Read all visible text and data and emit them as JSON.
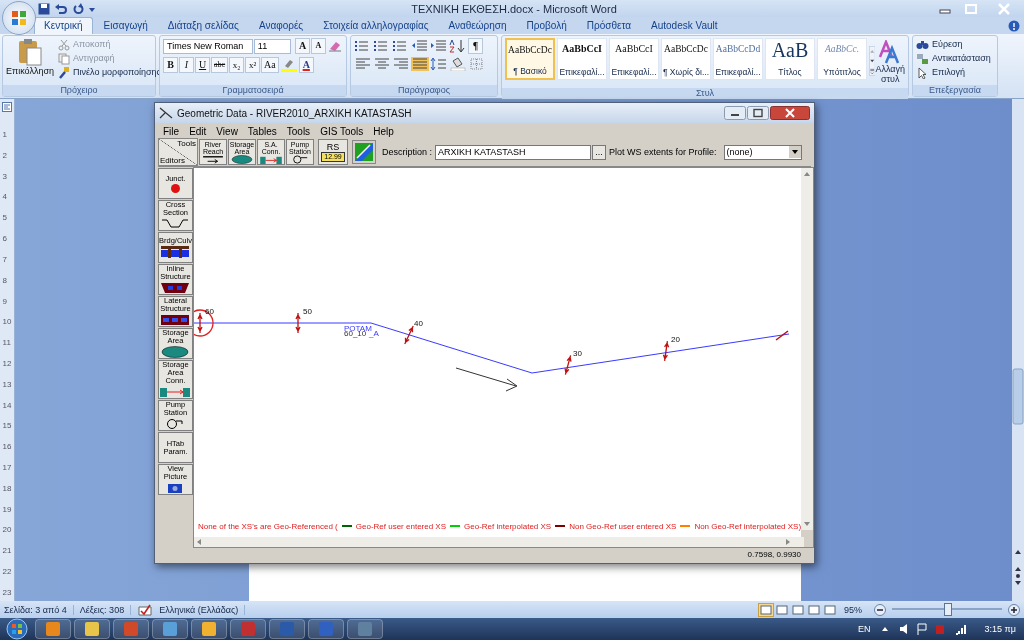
{
  "word": {
    "title": "ΤΕΧΝΙΚΗ ΕΚΘΕΣΗ.docx - Microsoft Word",
    "tabs": [
      {
        "label": "Κεντρική",
        "selected": true
      },
      {
        "label": "Εισαγωγή",
        "selected": false
      },
      {
        "label": "Διάταξη σελίδας",
        "selected": false
      },
      {
        "label": "Αναφορές",
        "selected": false
      },
      {
        "label": "Στοιχεία αλληλογραφίας",
        "selected": false
      },
      {
        "label": "Αναθεώρηση",
        "selected": false
      },
      {
        "label": "Προβολή",
        "selected": false
      },
      {
        "label": "Πρόσθετα",
        "selected": false
      },
      {
        "label": "Autodesk Vault",
        "selected": false
      }
    ],
    "clipboard": {
      "group": "Πρόχειρο",
      "paste": "Επικόλληση",
      "items": [
        {
          "label": "Αποκοπή",
          "kind": "cut",
          "disabled": true
        },
        {
          "label": "Αντιγραφή",
          "kind": "copy",
          "disabled": true
        },
        {
          "label": "Πινέλο μορφοποίησης",
          "kind": "brush",
          "disabled": false
        }
      ]
    },
    "font": {
      "group": "Γραμματοσειρά",
      "family": "Times New Roman",
      "size": "11",
      "grow": "A",
      "shrink": "A",
      "buttons": [
        {
          "label": "B",
          "kind": "bold"
        },
        {
          "label": "I",
          "kind": "italic"
        },
        {
          "label": "U",
          "kind": "underline"
        },
        {
          "label": "abc",
          "kind": "strike"
        },
        {
          "label": "x₂",
          "kind": "sub"
        },
        {
          "label": "x²",
          "kind": "sup"
        },
        {
          "label": "Aa",
          "kind": "case"
        }
      ],
      "color_button": "A"
    },
    "paragraph": {
      "group": "Παράγραφος",
      "pilcrow": "¶"
    },
    "styles": {
      "group": "Στυλ",
      "change": "Αλλαγή στυλ",
      "items": [
        {
          "sample": "AaBbCcDc",
          "name": "¶ Βασικό",
          "kind": "body",
          "selected": true
        },
        {
          "sample": "AaBbCcI",
          "name": "Επικεφαλί...",
          "kind": "heading1",
          "selected": false
        },
        {
          "sample": "AaBbCcI",
          "name": "Επικεφαλί...",
          "kind": "heading2",
          "selected": false
        },
        {
          "sample": "AaBbCcDc",
          "name": "¶ Χωρίς δι...",
          "kind": "nospacing",
          "selected": false
        },
        {
          "sample": "AaBbCcDd",
          "name": "Επικεφαλί...",
          "kind": "heading3",
          "selected": false
        },
        {
          "sample": "AaB",
          "name": "Τίτλος",
          "kind": "title",
          "selected": false
        },
        {
          "sample": "AaBbCc.",
          "name": "Υπότιτλος",
          "kind": "subtitle",
          "selected": false
        }
      ]
    },
    "editing": {
      "group": "Επεξεργασία",
      "items": [
        {
          "label": "Εύρεση",
          "kind": "find"
        },
        {
          "label": "Αντικατάσταση",
          "kind": "replace"
        },
        {
          "label": "Επιλογή",
          "kind": "select"
        }
      ]
    },
    "ruler_numbers": [
      "1",
      "2",
      "3",
      "4",
      "5",
      "6",
      "7",
      "8",
      "9",
      "10",
      "11",
      "12",
      "13",
      "14",
      "15",
      "16",
      "17",
      "18",
      "19",
      "20",
      "21",
      "22",
      "23"
    ]
  },
  "dialog": {
    "title": "Geometric Data - RIVER2010_ARXIKH KATASTASH",
    "menu": [
      "File",
      "Edit",
      "View",
      "Tables",
      "Tools",
      "GIS Tools",
      "Help"
    ],
    "tools_label": "Tools",
    "editors_label": "Editors",
    "tool_buttons": [
      {
        "label": "River Reach",
        "kind": "reach"
      },
      {
        "label": "Storage Area",
        "kind": "storage"
      },
      {
        "label": "S.A. Conn.",
        "kind": "conn"
      },
      {
        "label": "Pump Station",
        "kind": "pump"
      }
    ],
    "rs_button": {
      "label": "RS",
      "tag": "12.99"
    },
    "description_label": "Description :",
    "description": "ARXIKH KATASTASH",
    "browse": "...",
    "profile_label": "Plot WS extents for Profile:",
    "profile": "(none)",
    "editors": [
      {
        "label": "Junct.",
        "kind": "junction"
      },
      {
        "label": "Cross Section",
        "kind": "xs"
      },
      {
        "label": "Brdg/Culv",
        "kind": "bridge"
      },
      {
        "label": "Inline Structure",
        "kind": "inline"
      },
      {
        "label": "Lateral Structure",
        "kind": "lateral"
      },
      {
        "label": "Storage Area",
        "kind": "storage"
      },
      {
        "label": "Storage Area Conn.",
        "kind": "conn"
      },
      {
        "label": "Pump Station",
        "kind": "pump"
      },
      {
        "label": "HTab Param.",
        "kind": "none"
      },
      {
        "label": "View Picture",
        "kind": "picture"
      }
    ],
    "cross_sections": [
      {
        "label": "60",
        "highlighted": true
      },
      {
        "label": "50",
        "highlighted": false
      },
      {
        "label": "40",
        "highlighted": false
      },
      {
        "label": "30",
        "highlighted": false
      },
      {
        "label": "20",
        "highlighted": false
      }
    ],
    "river_label": "POTAM",
    "reach_label": "60_10",
    "reach_suffix": "_A",
    "legend": {
      "intro": "None of the XS's are Geo-Referenced (",
      "items": [
        {
          "label": "Geo-Ref user entered XS",
          "color": "#006400"
        },
        {
          "label": "Geo-Ref interpolated XS",
          "color": "#00d000"
        },
        {
          "label": "Non Geo-Ref user entered XS",
          "color": "#800000"
        },
        {
          "label": "Non Geo-Ref interpolated XS)",
          "color": "#ff8000"
        }
      ]
    },
    "coordinates": "0.7598, 0.9930"
  },
  "status_bar": {
    "page": "Σελίδα: 3 από 4",
    "words": "Λέξεις: 308",
    "language": "Ελληνικά (Ελλάδας)",
    "zoom": "95%",
    "zoom_slider": {
      "level": 0.5
    }
  },
  "taskbar": {
    "language": "EN",
    "time": "3:15 πμ"
  }
}
